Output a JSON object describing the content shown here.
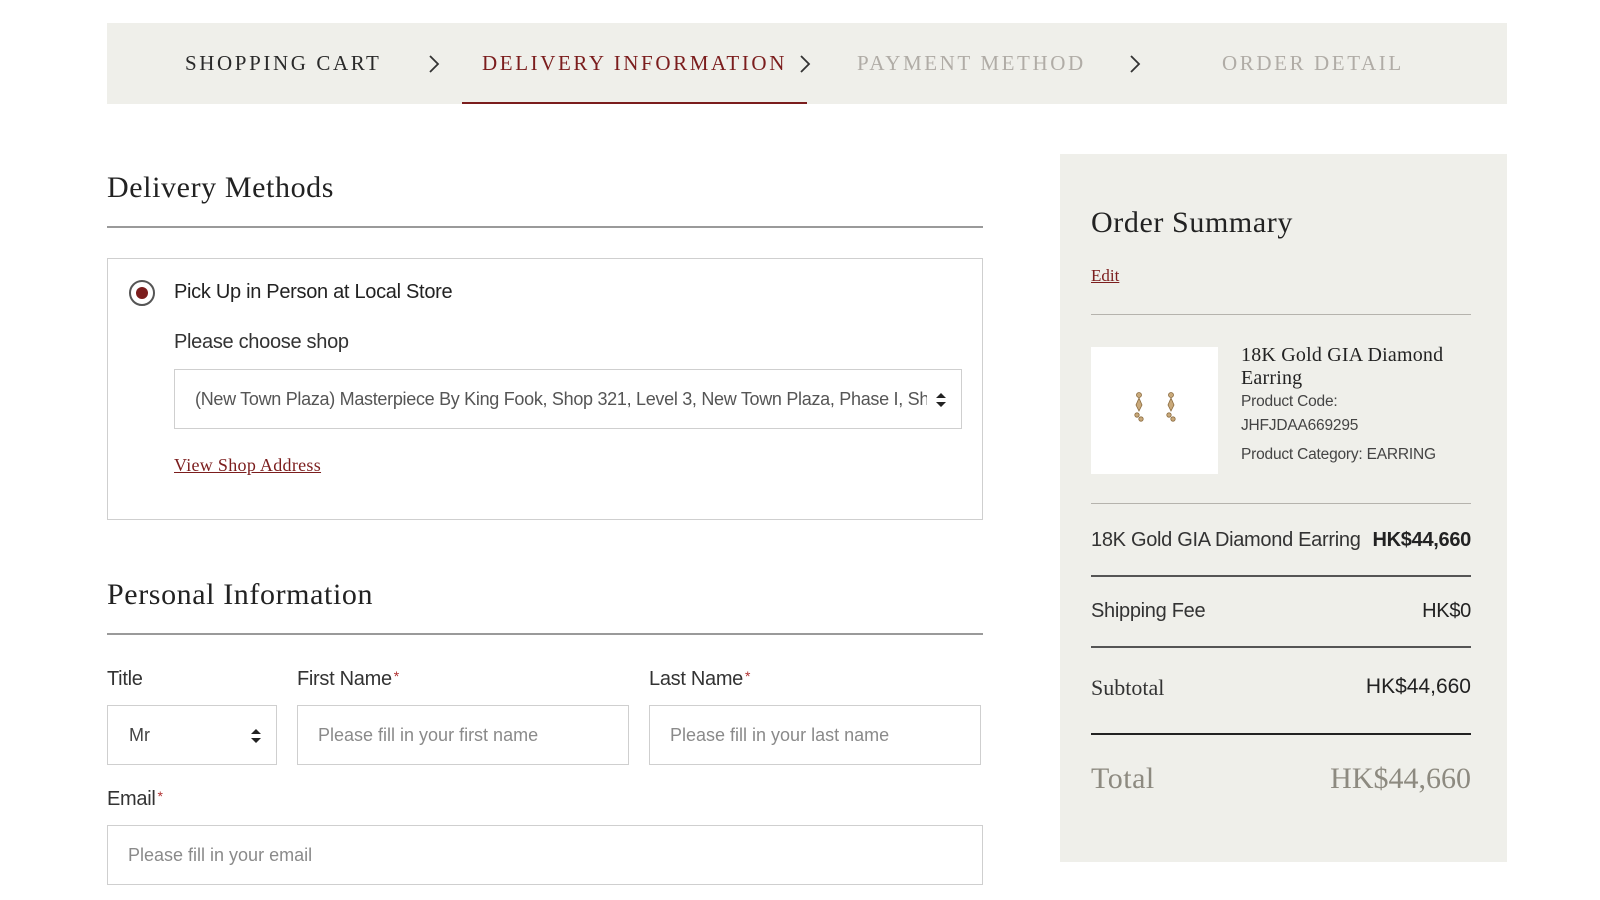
{
  "stepper": {
    "steps": [
      {
        "label": "SHOPPING CART",
        "state": "done"
      },
      {
        "label": "DELIVERY INFORMATION",
        "state": "active"
      },
      {
        "label": "PAYMENT METHOD",
        "state": "pending"
      },
      {
        "label": "ORDER DETAIL",
        "state": "pending"
      }
    ],
    "separator_icon": "chevron-right-icon"
  },
  "delivery": {
    "title": "Delivery Methods",
    "option_label": "Pick Up in Person at Local Store",
    "option_selected": true,
    "choose_shop_label": "Please choose shop",
    "shop_selected": "(New Town Plaza) Masterpiece By King Fook, Shop 321, Level 3, New Town Plaza, Phase I, Sha Tin",
    "view_shop_link": "View Shop Address"
  },
  "personal": {
    "title": "Personal Information",
    "title_label": "Title",
    "title_value": "Mr",
    "first_name_label": "First Name",
    "first_name_placeholder": "Please fill in your first name",
    "last_name_label": "Last Name",
    "last_name_placeholder": "Please fill in your last name",
    "email_label": "Email",
    "email_placeholder": "Please fill in your email",
    "required_mark": "*"
  },
  "summary": {
    "title": "Order Summary",
    "edit_label": "Edit",
    "product": {
      "name": "18K Gold GIA Diamond Earring",
      "code_label": "Product Code:",
      "code": "JHFJDAA669295",
      "category_text": "Product Category: EARRING"
    },
    "item_line": {
      "label": "18K Gold GIA Diamond Earring",
      "value": "HK$44,660"
    },
    "shipping": {
      "label": "Shipping Fee",
      "value": "HK$0"
    },
    "subtotal": {
      "label": "Subtotal",
      "value": "HK$44,660"
    },
    "total": {
      "label": "Total",
      "value": "HK$44,660"
    }
  },
  "colors": {
    "accent": "#7b1d1d",
    "panel_bg": "#efefea",
    "muted_step": "#b0aca6"
  }
}
